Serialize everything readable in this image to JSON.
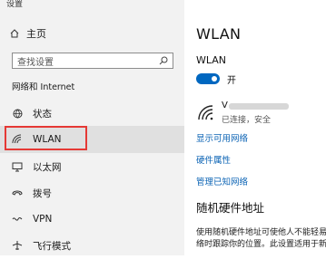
{
  "window": {
    "title": "设置"
  },
  "sidebar": {
    "home_label": "主页",
    "search_placeholder": "查找设置",
    "section_title": "网络和 Internet",
    "items": [
      {
        "label": "状态",
        "icon": "status-globe-icon"
      },
      {
        "label": "WLAN",
        "icon": "wifi-icon",
        "active": true
      },
      {
        "label": "以太网",
        "icon": "ethernet-icon"
      },
      {
        "label": "拨号",
        "icon": "dialup-icon"
      },
      {
        "label": "VPN",
        "icon": "vpn-icon"
      },
      {
        "label": "飞行模式",
        "icon": "airplane-icon"
      }
    ]
  },
  "main": {
    "title": "WLAN",
    "wlan_label": "WLAN",
    "toggle_state": "开",
    "network": {
      "name_prefix": "V",
      "status": "已连接，安全"
    },
    "links": [
      "显示可用网络",
      "硬件属性",
      "管理已知网络"
    ],
    "random_hw": {
      "heading": "随机硬件地址",
      "desc_line1": "使用随机硬件地址可使他人不能轻易",
      "desc_line2": "络时跟踪你的位置。此设置适用于新"
    }
  },
  "colors": {
    "accent": "#0067c0",
    "link": "#0b63b4",
    "highlight_border": "#e53935",
    "sidebar_bg": "#f2f2f2"
  }
}
